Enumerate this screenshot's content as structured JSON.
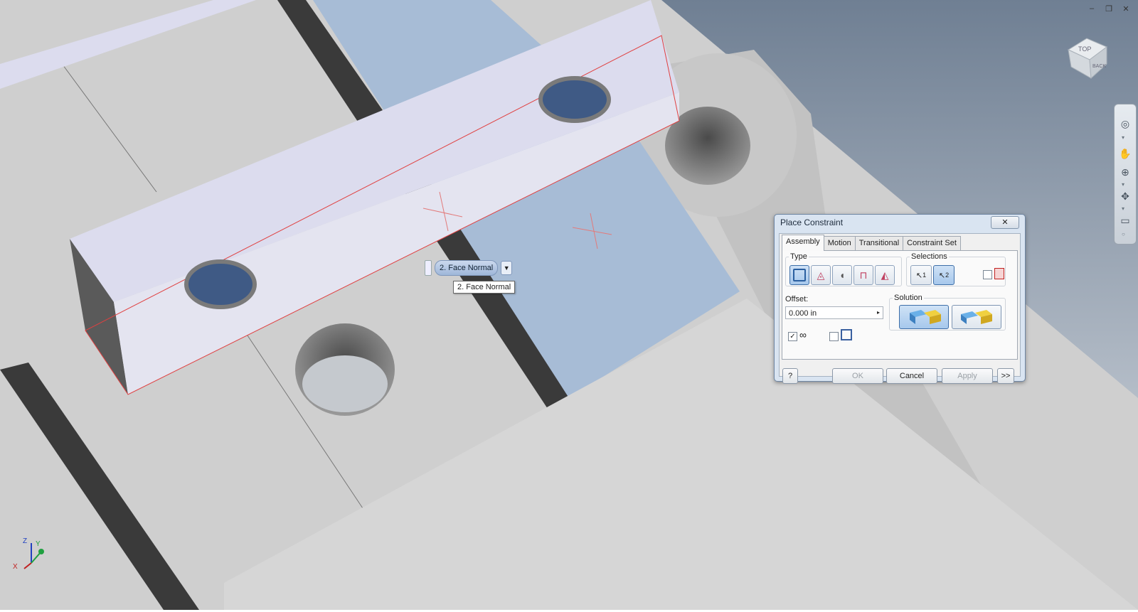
{
  "window_controls": {
    "minimize": "–",
    "restore": "❐",
    "close": "✕"
  },
  "viewcube": {
    "top_label": "TOP",
    "back_label": "BACK"
  },
  "navbar": {
    "items": [
      "steering-wheel-icon",
      "pan-icon",
      "zoom-icon",
      "orbit-icon",
      "look-at-icon"
    ]
  },
  "minitoolbar": {
    "solution_label": "2. Face Normal",
    "dropdown_glyph": "▼"
  },
  "tooltip": {
    "text": "2. Face Normal"
  },
  "axis": {
    "z": "Z",
    "x": "X",
    "y": "Y"
  },
  "dialog": {
    "title": "Place Constraint",
    "close_glyph": "✕",
    "tabs": [
      "Assembly",
      "Motion",
      "Transitional",
      "Constraint Set"
    ],
    "type_legend": "Type",
    "selections_legend": "Selections",
    "selection_1": "1",
    "selection_2": "2",
    "offset_label": "Offset:",
    "offset_value": "0.000 in",
    "solution_legend": "Solution",
    "preview_checked": "✓",
    "help_glyph": "?",
    "ok_label": "OK",
    "cancel_label": "Cancel",
    "apply_label": "Apply",
    "more_label": ">>"
  },
  "colors": {
    "sky_top": "#6f7f93",
    "sky_bottom": "#d9dee4",
    "part_gray": "#d0d0d0",
    "selected_face": "#a7bcd6",
    "bar_face": "#dcdcee",
    "constraint_red": "#e04040",
    "dialog_bg": "#d9e4f1"
  }
}
